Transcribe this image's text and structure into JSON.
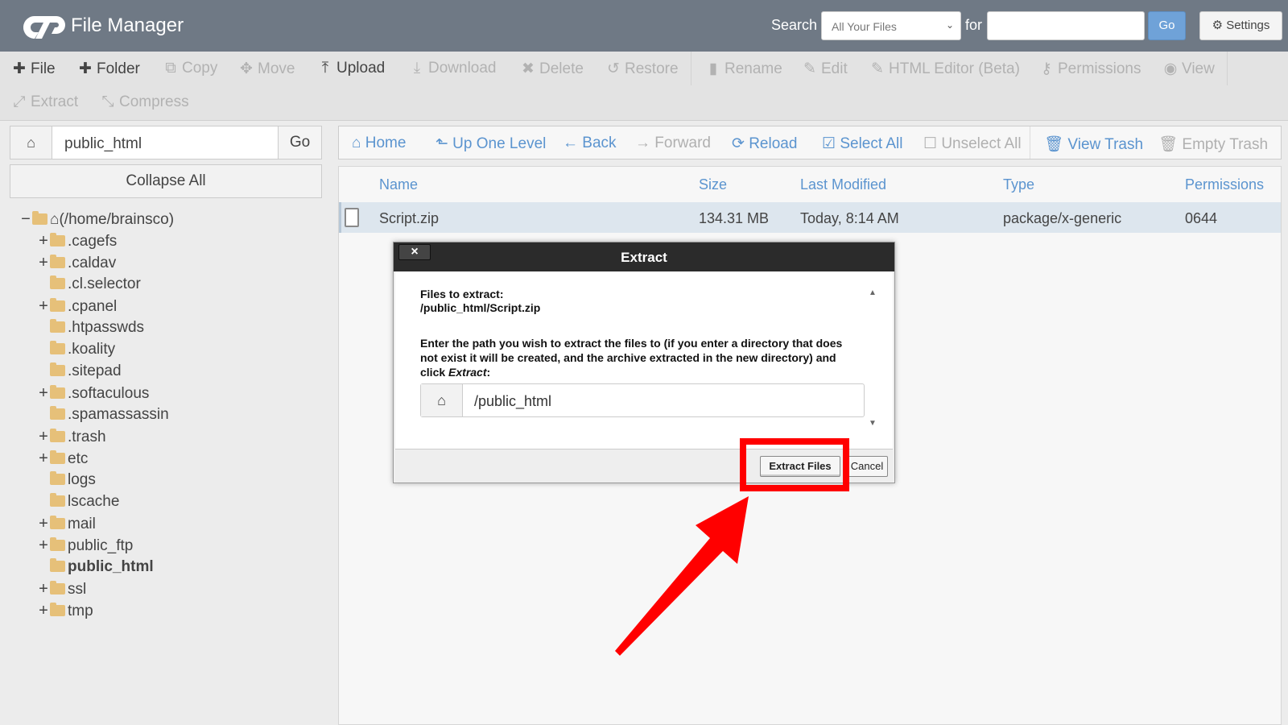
{
  "header": {
    "app_title": "File Manager",
    "search_label": "Search",
    "search_scope": "All Your Files",
    "for_label": "for",
    "search_value": "",
    "go_label": "Go",
    "settings_label": "Settings"
  },
  "toolbar": {
    "file": "File",
    "folder": "Folder",
    "copy": "Copy",
    "move": "Move",
    "upload": "Upload",
    "download": "Download",
    "delete": "Delete",
    "restore": "Restore",
    "rename": "Rename",
    "edit": "Edit",
    "html_editor": "HTML Editor (Beta)",
    "permissions": "Permissions",
    "view": "View",
    "extract": "Extract",
    "compress": "Compress"
  },
  "sidebar": {
    "path_value": "public_html",
    "go_label": "Go",
    "collapse_label": "Collapse All",
    "root": "(/home/brainsco)",
    "items": [
      {
        "label": ".cagefs"
      },
      {
        "label": ".caldav"
      },
      {
        "label": ".cl.selector"
      },
      {
        "label": ".cpanel"
      },
      {
        "label": ".htpasswds"
      },
      {
        "label": ".koality"
      },
      {
        "label": ".sitepad"
      },
      {
        "label": ".softaculous"
      },
      {
        "label": ".spamassassin"
      },
      {
        "label": ".trash"
      },
      {
        "label": "etc"
      },
      {
        "label": "logs"
      },
      {
        "label": "lscache"
      },
      {
        "label": "mail"
      },
      {
        "label": "public_ftp"
      },
      {
        "label": "public_html"
      },
      {
        "label": "ssl"
      },
      {
        "label": "tmp"
      }
    ]
  },
  "nav": {
    "home": "Home",
    "up": "Up One Level",
    "back": "Back",
    "forward": "Forward",
    "reload": "Reload",
    "select_all": "Select All",
    "unselect_all": "Unselect All",
    "view_trash": "View Trash",
    "empty_trash": "Empty Trash"
  },
  "table": {
    "headers": {
      "name": "Name",
      "size": "Size",
      "modified": "Last Modified",
      "type": "Type",
      "perms": "Permissions"
    },
    "rows": [
      {
        "name": "Script.zip",
        "size": "134.31 MB",
        "modified": "Today, 8:14 AM",
        "type": "package/x-generic",
        "perms": "0644"
      }
    ]
  },
  "modal": {
    "close": "×",
    "title": "Extract",
    "files_label": "Files to extract:",
    "files_value": "/public_html/Script.zip",
    "instruction": "Enter the path you wish to extract the files to (if you enter a directory that does not exist it will be created, and the archive extracted in the new directory) and click ",
    "instruction_em": "Extract",
    "instruction_end": ":",
    "path_value": "/public_html",
    "extract_btn": "Extract Files",
    "cancel_btn": "Cancel"
  },
  "colors": {
    "header_bg": "#6f7985",
    "link_blue": "#5b94cf",
    "folder": "#e6c079",
    "annotation_red": "#ff0000"
  }
}
